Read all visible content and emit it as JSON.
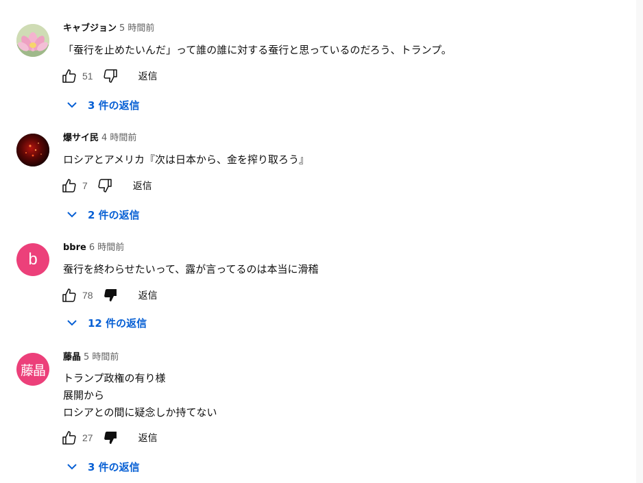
{
  "comments": [
    {
      "author": "キャブジョン",
      "time": "5 時間前",
      "avatar": {
        "type": "image",
        "name": "lotus-flower-avatar"
      },
      "lines": [
        "「蚕行を止めたいんだ」って誰の誰に対する蚕行と思っているのだろう、トランプ。"
      ],
      "likes": "51",
      "dislike_active": false,
      "reply_label": "返信",
      "replies_label": "3 件の返信"
    },
    {
      "author": "爆サイ民",
      "time": "4 時間前",
      "avatar": {
        "type": "image",
        "name": "dark-red-particles-avatar"
      },
      "lines": [
        "ロシアとアメリカ『次は日本から、金を搾り取ろう』"
      ],
      "likes": "7",
      "dislike_active": false,
      "reply_label": "返信",
      "replies_label": "2 件の返信"
    },
    {
      "author": "bbre",
      "time": "6 時間前",
      "avatar": {
        "type": "letter",
        "text": "b",
        "color": "#ec407a"
      },
      "lines": [
        "蚕行を終わらせたいって、露が言ってるのは本当に滑稽"
      ],
      "likes": "78",
      "dislike_active": true,
      "reply_label": "返信",
      "replies_label": "12 件の返信"
    },
    {
      "author": "藤晶",
      "time": "5 時間前",
      "avatar": {
        "type": "letter",
        "text": "藤晶",
        "color": "#ec407a"
      },
      "lines": [
        "トランプ政権の有り様",
        "展開から",
        "ロシアとの間に疑念しか持てない"
      ],
      "likes": "27",
      "dislike_active": true,
      "reply_label": "返信",
      "replies_label": "3 件の返信"
    }
  ],
  "colors": {
    "link": "#065fd4",
    "secondary_text": "#606060",
    "primary_text": "#0f0f0f",
    "avatar_pink": "#ec407a"
  },
  "icons": {
    "like": "thumbs-up-icon",
    "dislike": "thumbs-down-icon",
    "expand": "chevron-down-icon"
  }
}
